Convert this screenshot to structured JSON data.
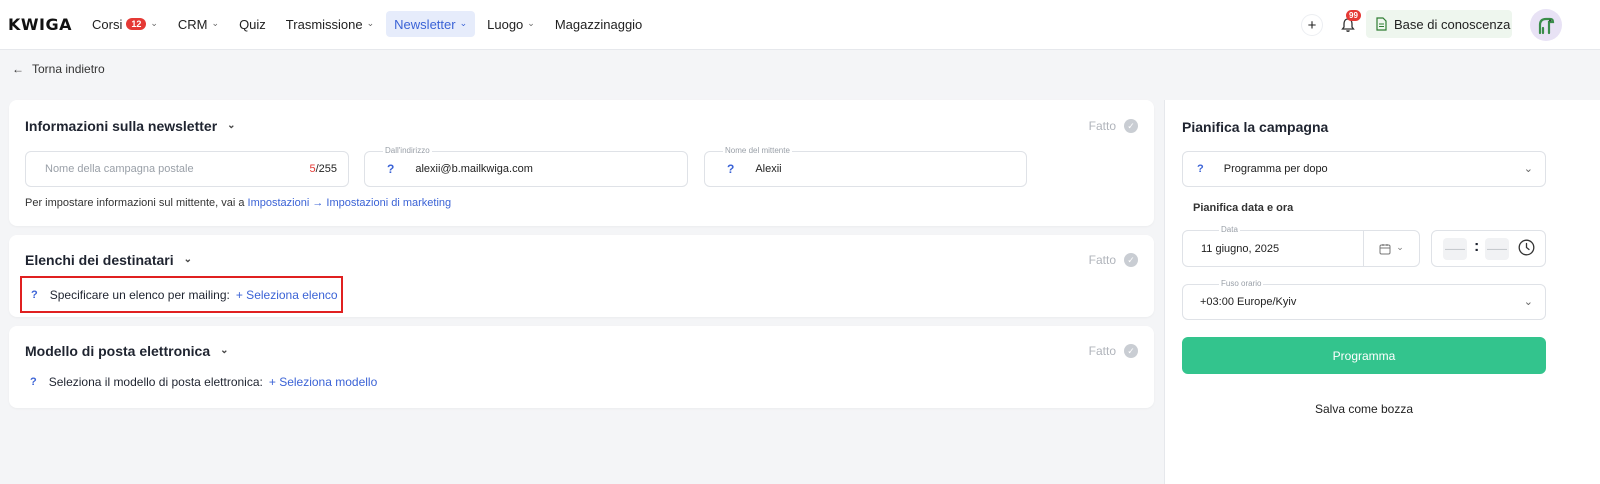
{
  "app": {
    "logo": "KWIGA"
  },
  "nav": {
    "items": [
      {
        "label": "Corsi",
        "badge": "12",
        "dropdown": true
      },
      {
        "label": "CRM",
        "dropdown": true
      },
      {
        "label": "Quiz",
        "dropdown": false
      },
      {
        "label": "Trasmissione",
        "dropdown": true
      },
      {
        "label": "Newsletter",
        "dropdown": true,
        "active": true
      },
      {
        "label": "Luogo",
        "dropdown": true
      },
      {
        "label": "Magazzinaggio",
        "dropdown": false
      }
    ]
  },
  "header_right": {
    "plus_icon": "plus-icon",
    "notifications_badge": "99",
    "knowledge_base_label": "Base di conoscenza"
  },
  "back_link": "Torna indietro",
  "newsletter_info": {
    "title": "Informazioni sulla newsletter",
    "done_label": "Fatto",
    "campaign_name_placeholder": "Nome della campagna postale",
    "counter_current": "5",
    "counter_max": "/255",
    "from_address_label": "Dall'indirizzo",
    "from_address_value": "alexii@b.mailkwiga.com",
    "sender_name_label": "Nome del mittente",
    "sender_name_value": "Alexii",
    "help_mark": "?",
    "hint_text": "Per impostare informazioni sul mittente, vai a",
    "hint_link": "Impostazioni → Impostazioni di marketing"
  },
  "recipients": {
    "title": "Elenchi dei destinatari",
    "done_label": "Fatto",
    "help_mark": "?",
    "prompt": "Specificare un elenco per mailing:",
    "link": "+ Seleziona elenco"
  },
  "template": {
    "title": "Modello di posta elettronica",
    "done_label": "Fatto",
    "help_mark": "?",
    "prompt": "Seleziona il modello di posta elettronica:",
    "link": "+ Seleziona modello"
  },
  "schedule": {
    "title": "Pianifica la campagna",
    "help_mark": "?",
    "mode_value": "Programma per dopo",
    "datetime_label": "Pianifica data e ora",
    "date_label": "Data",
    "date_value": "11 giugno, 2025",
    "hour_placeholder": "——",
    "minute_placeholder": "——",
    "time_separator": ":",
    "timezone_label": "Fuso orario",
    "timezone_value": "+03:00 Europe/Kyiv",
    "primary_button": "Programma",
    "draft_button": "Salva come bozza"
  },
  "colors": {
    "accent": "#3b63d6",
    "primary_button": "#33c48d",
    "badge": "#e53935",
    "highlight_box": "#e02020"
  }
}
